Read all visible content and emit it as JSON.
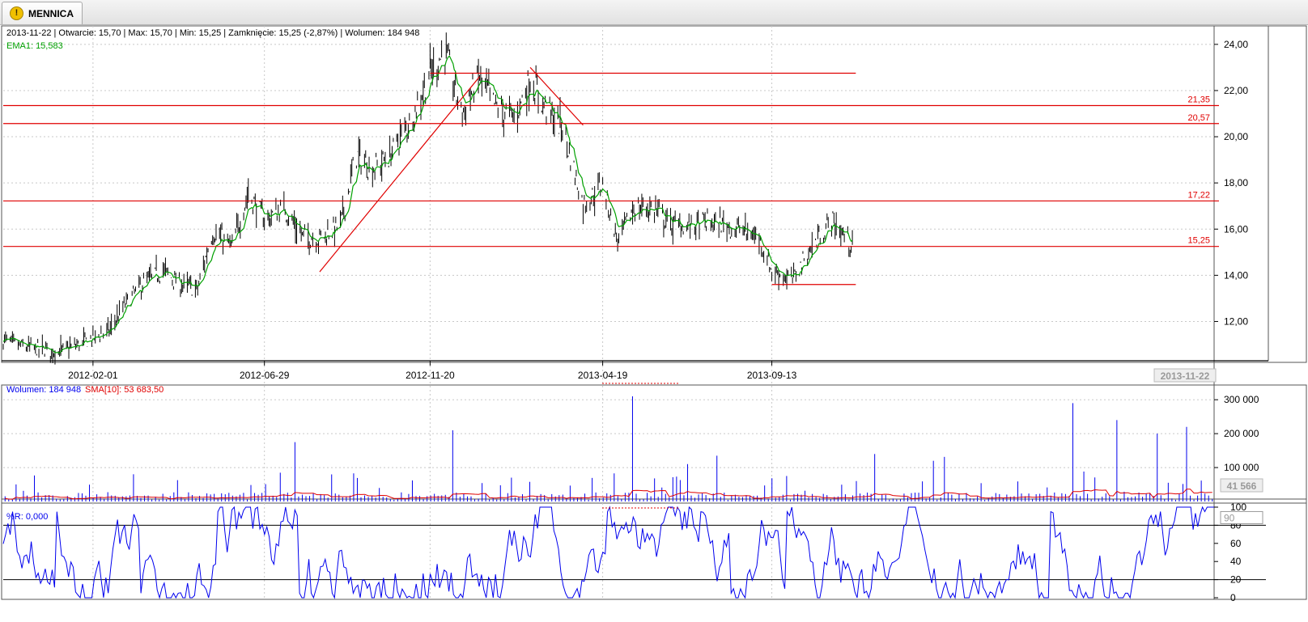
{
  "tab": {
    "title": "MENNICA",
    "icon": "warning-icon"
  },
  "colors": {
    "price_bar": "#000000",
    "ema": "#00a000",
    "trendline": "#e00000",
    "volume": "#0000ee",
    "sma": "#e00000",
    "wr": "#0000ee",
    "grid": "#c8c8c8"
  },
  "price_info": {
    "line": "2013-11-22 | Otwarcie: 15,70 | Max: 15,70 | Min: 15,25 | Zamknięcie: 15,25 (-2,87%)  | Wolumen: 184 948",
    "ema": "EMA1: 15,583"
  },
  "volume_info": {
    "volume": "Wolumen: 184 948",
    "sma": "SMA[10]: 53 683,50"
  },
  "wr_info": {
    "label": "%R: 0,000"
  },
  "chart_data": [
    {
      "type": "ohlc",
      "x": [
        "2011-11-15",
        "2011-12-01",
        "2011-12-15",
        "2012-01-02",
        "2012-01-16",
        "2012-02-01",
        "2012-02-15",
        "2012-03-01",
        "2012-03-15",
        "2012-04-02",
        "2012-04-16",
        "2012-05-02",
        "2012-05-15",
        "2012-06-01",
        "2012-06-15",
        "2012-06-29",
        "2012-07-16",
        "2012-08-01",
        "2012-08-16",
        "2012-09-03",
        "2012-09-17",
        "2012-10-01",
        "2012-10-15",
        "2012-11-02",
        "2012-11-20",
        "2012-12-03",
        "2012-12-17",
        "2013-01-02",
        "2013-01-16",
        "2013-02-01",
        "2013-02-15",
        "2013-03-01",
        "2013-03-15",
        "2013-04-02",
        "2013-04-19",
        "2013-05-02",
        "2013-05-16",
        "2013-06-03",
        "2013-06-17",
        "2013-07-01",
        "2013-07-15",
        "2013-08-01",
        "2013-08-16",
        "2013-09-02",
        "2013-09-13",
        "2013-10-01",
        "2013-10-15",
        "2013-11-04",
        "2013-11-22"
      ],
      "close": [
        11.2,
        10.9,
        10.8,
        10.7,
        10.9,
        11.3,
        11.6,
        12.8,
        13.6,
        14.2,
        13.6,
        13.4,
        15.9,
        15.2,
        17.6,
        16.4,
        16.9,
        15.7,
        15.6,
        16.2,
        19.2,
        18.6,
        19.1,
        20.6,
        22.8,
        23.7,
        21.0,
        22.6,
        21.3,
        20.8,
        22.5,
        21.2,
        20.4,
        17.1,
        17.9,
        15.5,
        16.9,
        16.9,
        16.2,
        16.1,
        16.3,
        16.2,
        16.0,
        15.6,
        14.2,
        13.8,
        15.0,
        16.4,
        15.25
      ],
      "ema_label": "EMA1",
      "ylim": [
        10.3,
        24.8
      ],
      "y_ticks": [
        "24,00",
        "22,00",
        "20,00",
        "18,00",
        "16,00",
        "14,00",
        "12,00"
      ],
      "x_ticks": [
        "2012-02-01",
        "2012-06-29",
        "2012-11-20",
        "2013-04-19",
        "2013-09-13"
      ],
      "last_date_label": "2013-11-22",
      "h_levels": [
        21.35,
        20.57,
        17.22,
        15.25
      ],
      "h_level_labels": [
        "21,35",
        "20,57",
        "17,22",
        "15,25"
      ],
      "trendlines": [
        {
          "from": [
            "2012-08-16",
            14.15
          ],
          "to": [
            "2013-01-02",
            22.6
          ]
        },
        {
          "from": [
            "2012-11-20",
            22.75
          ],
          "to": [
            "2013-11-25",
            22.75
          ]
        },
        {
          "from": [
            "2013-02-15",
            23.0
          ],
          "to": [
            "2013-04-02",
            20.5
          ]
        },
        {
          "from": [
            "2013-09-13",
            13.6
          ],
          "to": [
            "2013-11-25",
            13.6
          ]
        }
      ]
    },
    {
      "type": "bar",
      "title": "Wolumen",
      "y_ticks": [
        "300 000",
        "200 000",
        "100 000"
      ],
      "ylim": [
        0,
        310000
      ],
      "peaks": [
        [
          0.24,
          175000
        ],
        [
          0.37,
          210000
        ],
        [
          0.52,
          310000
        ],
        [
          0.59,
          135000
        ],
        [
          0.72,
          140000
        ],
        [
          0.77,
          120000
        ],
        [
          0.885,
          290000
        ],
        [
          0.92,
          240000
        ],
        [
          0.955,
          200000
        ],
        [
          0.98,
          220000
        ]
      ],
      "sma_label": "SMA[10]",
      "last_value_label": "41 566"
    },
    {
      "type": "line",
      "title": "%R",
      "ylim": [
        0,
        100
      ],
      "y_ticks": [
        "100",
        "80",
        "60",
        "40",
        "20",
        "0"
      ],
      "levels": [
        80,
        20
      ],
      "level_label": "90"
    }
  ]
}
